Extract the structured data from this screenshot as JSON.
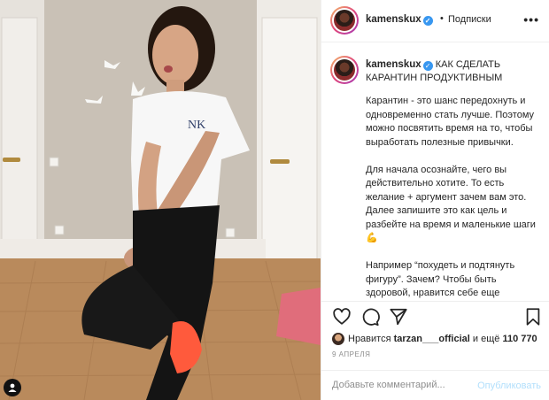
{
  "post": {
    "username": "kamenskux",
    "verified_glyph": "✓",
    "separator": "•",
    "follow_label": "Подписки",
    "more_label": "•••",
    "caption_title": "КАК СДЕЛАТЬ КАРАНТИН ПРОДУКТИВНЫМ",
    "caption_paragraphs": [
      "Карантин - это шанс передохнуть и одновременно стать лучше. Поэтому можно посвятить время на то, чтобы выработать полезные привычки.",
      "Для начала осознайте, чего вы действительно хотите. То есть желание + аргумент зачем вам это. Далее запишите это как цель и разбейте на время и маленькие шаги 💪",
      "Например “похудеть и подтянуть фигуру”. Зачем? Чтобы быть здоровой, нравится себе еще"
    ]
  },
  "engagement": {
    "likes_prefix": "Нравится",
    "liker": "tarzan___official",
    "likes_joiner": "и ещё",
    "likes_count": "110 770",
    "date": "9 апреля"
  },
  "comment": {
    "placeholder": "Добавьте комментарий...",
    "publish_label": "Опубликовать"
  },
  "photo": {
    "shirt_print": "NK"
  },
  "icons": {
    "like": "heart-icon",
    "comment": "comment-icon",
    "share": "share-icon",
    "save": "bookmark-icon",
    "tag": "user-tag-icon",
    "more": "more-dots-icon"
  },
  "colors": {
    "verified": "#3897f0",
    "publish_disabled": "#b2dffc",
    "muted": "#8e8e8e",
    "border": "#efefef"
  }
}
